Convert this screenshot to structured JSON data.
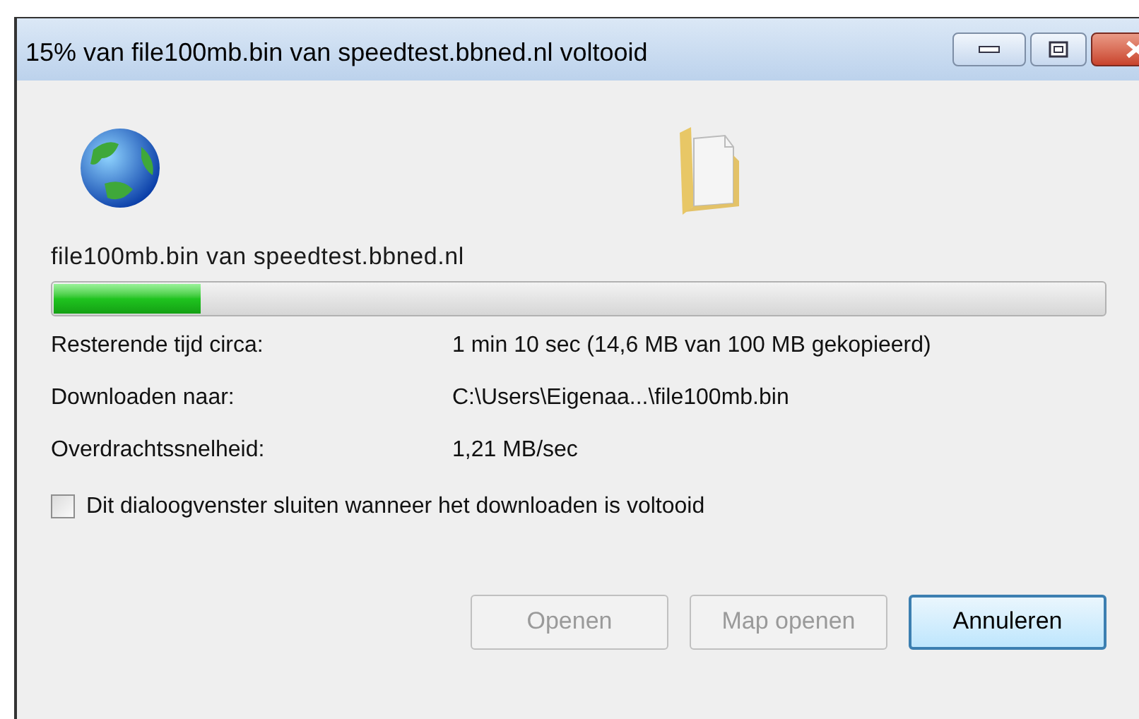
{
  "window": {
    "title": "15% van file100mb.bin van speedtest.bbned.nl voltooid"
  },
  "download": {
    "file_label": "file100mb.bin van speedtest.bbned.nl",
    "progress": {
      "level": 0.14
    },
    "details": [
      {
        "label": "Resterende tijd circa:",
        "value": "1 min 10 sec (14,6 MB van 100 MB gekopieerd)"
      },
      {
        "label": "Downloaden naar:",
        "value": "C:\\Users\\Eigenaa...\\file100mb.bin"
      },
      {
        "label": "Overdrachtssnelheid:",
        "value": "1,21 MB/sec"
      }
    ]
  },
  "close_when_done": {
    "label": "Dit dialoogvenster sluiten wanneer het downloaden is voltooid",
    "checked": false
  },
  "buttons": [
    {
      "label": "Openen",
      "disabled": true,
      "default": false
    },
    {
      "label": "Map openen",
      "disabled": true,
      "default": false
    },
    {
      "label": "Annuleren",
      "disabled": false,
      "default": true
    }
  ]
}
